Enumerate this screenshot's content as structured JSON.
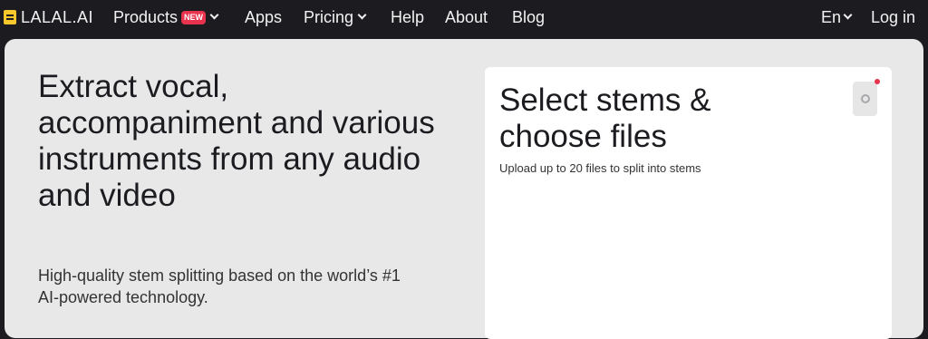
{
  "nav": {
    "logo_text": "LALAL.AI",
    "items": [
      {
        "label": "Products",
        "badge": "NEW",
        "has_dropdown": true
      },
      {
        "label": "Apps"
      },
      {
        "label": "Pricing",
        "has_dropdown": true
      },
      {
        "label": "Help"
      },
      {
        "label": "About"
      },
      {
        "label": "Blog"
      }
    ],
    "language": "En",
    "login": "Log in"
  },
  "hero": {
    "title": "Extract vocal, accompaniment and various instruments from any audio and video",
    "subtitle": "High-quality stem splitting based on the world’s #1 AI-powered technology."
  },
  "upload_card": {
    "title": "Select stems & choose files",
    "subtitle": "Upload up to 20 files to split into stems"
  },
  "colors": {
    "nav_bg": "#1c1b1f",
    "content_bg": "#e8e8e9",
    "card_bg": "#ffffff",
    "brand_yellow": "#f7c72b",
    "badge_red": "#e8334f"
  },
  "icons": {
    "logo": "lalal-logo-icon",
    "dropdown": "chevron-down-icon",
    "settings": "settings-icon"
  }
}
